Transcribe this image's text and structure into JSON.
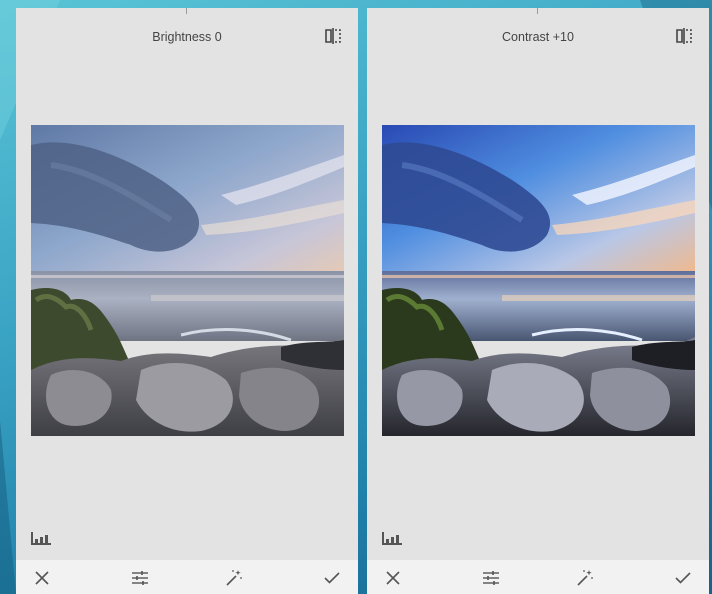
{
  "panels": [
    {
      "title": "Brightness 0",
      "variant": "original",
      "icons": {
        "compare": "compare-icon",
        "histogram": "histogram-icon",
        "cancel": "close-icon",
        "adjust": "sliders-icon",
        "auto": "magic-wand-icon",
        "apply": "checkmark-icon"
      }
    },
    {
      "title": "Contrast +10",
      "variant": "contrast",
      "icons": {
        "compare": "compare-icon",
        "histogram": "histogram-icon",
        "cancel": "close-icon",
        "adjust": "sliders-icon",
        "auto": "magic-wand-icon",
        "apply": "checkmark-icon"
      }
    }
  ],
  "colors": {
    "panel_bg": "#e3e3e3",
    "toolbar_bg": "#f2f2f2",
    "icon": "#555555",
    "slide_bg": "#3aa3c4"
  }
}
